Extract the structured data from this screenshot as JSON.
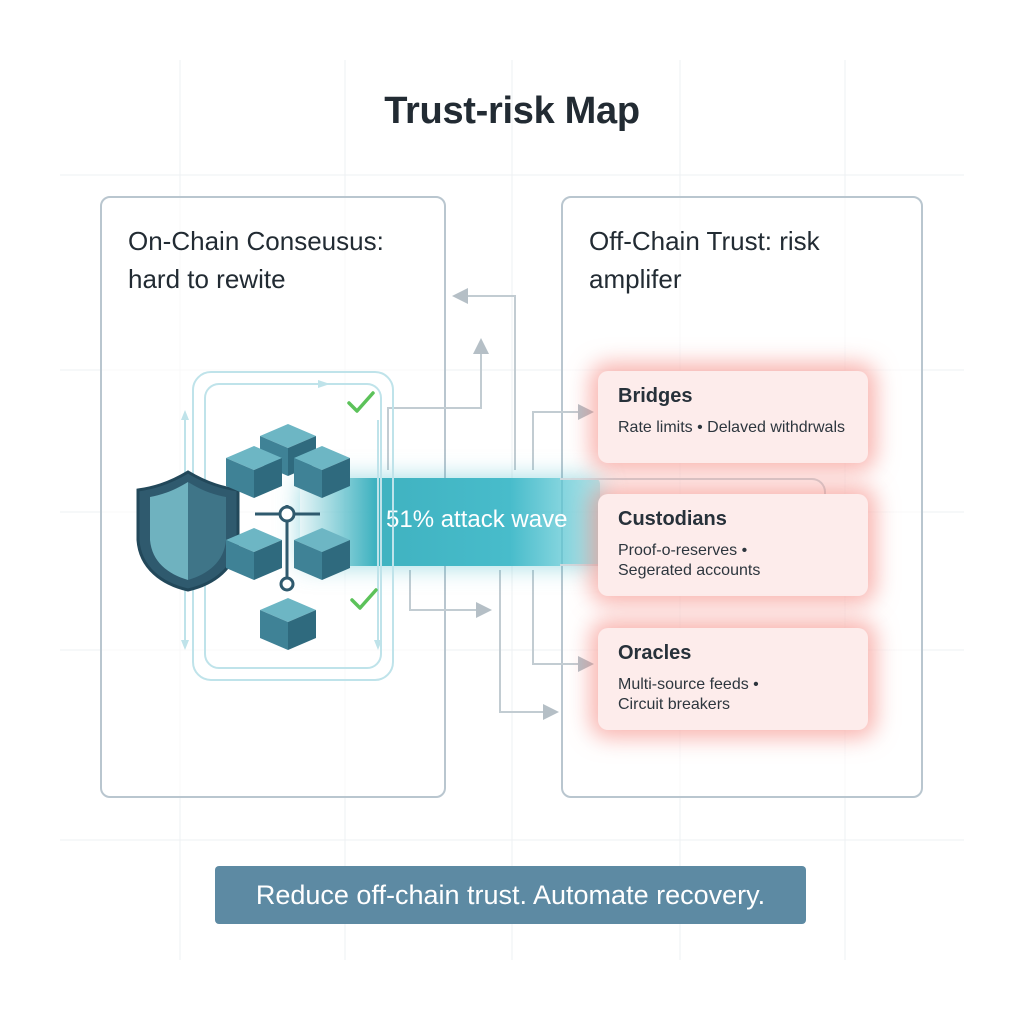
{
  "title": "Trust-risk Map",
  "left_panel": {
    "title_line1": "On-Chain Conseusus:",
    "title_line2": "hard to rewite"
  },
  "right_panel": {
    "title_line1": "Off-Chain Trust: risk",
    "title_line2": "amplifer"
  },
  "wave": {
    "label": "51% attack wave"
  },
  "cards": [
    {
      "title": "Bridges",
      "line1": "Rate limits • Delaved withdrwals",
      "line2": ""
    },
    {
      "title": "Custodians",
      "line1": "Proof-o-reserves •",
      "line2": "Segerated accounts"
    },
    {
      "title": "Oracles",
      "line1": "Multi-source feeds •",
      "line2": "Circuit breakers"
    }
  ],
  "banner": "Reduce off-chain trust. Automate recovery.",
  "icons": [
    "shield-icon",
    "blockchain-cubes-icon",
    "checkmark-icon"
  ],
  "colors": {
    "teal": "#48bccb",
    "cube_top": "#5da6b6",
    "shield": "#2f5a6e",
    "check": "#5cc25a",
    "card_glow": "#f47870",
    "banner": "#5d8aa3"
  }
}
